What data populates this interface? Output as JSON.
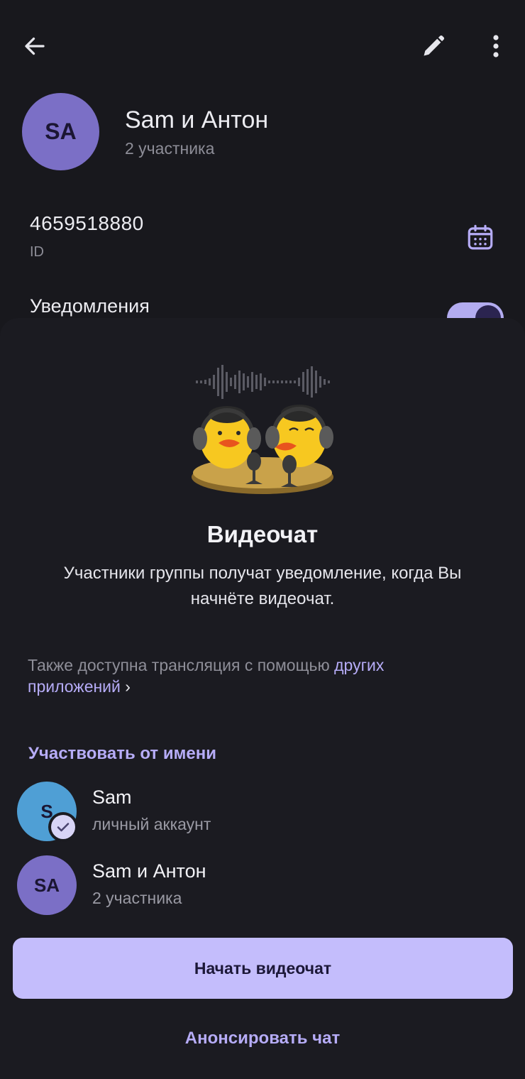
{
  "header": {
    "back_icon": "arrow-left-icon",
    "edit_icon": "pencil-icon",
    "more_icon": "more-vertical-icon"
  },
  "profile": {
    "avatar_initials": "SA",
    "name": "Sam и Антон",
    "subtitle": "2 участника",
    "id_value": "4659518880",
    "id_label": "ID",
    "notifications_label": "Уведомления",
    "notifications_enabled": true
  },
  "sheet": {
    "title": "Видеочат",
    "description": "Участники группы получат уведомление, когда Вы начнёте видеочат.",
    "also_text": "Также доступна трансляция с помощью ",
    "also_link": "других приложений",
    "also_link_chevron": "›",
    "section_header": "Участвовать от имени",
    "accounts": [
      {
        "initials": "S",
        "name": "Sam",
        "subtitle": "личный аккаунт",
        "selected": true
      },
      {
        "initials": "SA",
        "name": "Sam и Антон",
        "subtitle": "2 участника",
        "selected": false
      }
    ],
    "primary_button": "Начать видеочат",
    "secondary_button": "Анонсировать чат"
  },
  "colors": {
    "accent": "#b6acf7",
    "primary_button_bg": "#c4bdfc",
    "avatar_purple": "#7b6fc6",
    "avatar_blue": "#4f9fd5",
    "sheet_bg": "#1b1b21"
  }
}
